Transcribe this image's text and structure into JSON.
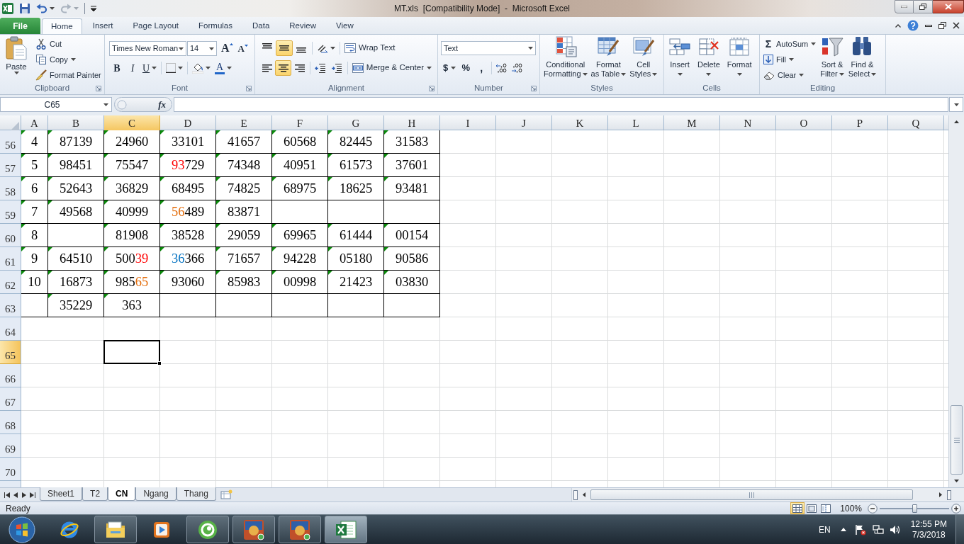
{
  "window": {
    "title": "MT.xls  [Compatibility Mode]  -  Microsoft Excel"
  },
  "ribbon_tabs": [
    {
      "label": "File",
      "kind": "file",
      "selected": false
    },
    {
      "label": "Home",
      "kind": "tab",
      "selected": true
    },
    {
      "label": "Insert",
      "kind": "tab",
      "selected": false
    },
    {
      "label": "Page Layout",
      "kind": "tab",
      "selected": false
    },
    {
      "label": "Formulas",
      "kind": "tab",
      "selected": false
    },
    {
      "label": "Data",
      "kind": "tab",
      "selected": false
    },
    {
      "label": "Review",
      "kind": "tab",
      "selected": false
    },
    {
      "label": "View",
      "kind": "tab",
      "selected": false
    }
  ],
  "clipboard": {
    "label": "Clipboard",
    "paste": "Paste",
    "cut": "Cut",
    "copy": "Copy",
    "format_painter": "Format Painter"
  },
  "font": {
    "label": "Font",
    "name": "Times New Roman",
    "size": "14",
    "grow": "A",
    "shrink": "A",
    "bold": "B",
    "italic": "I",
    "underline": "U",
    "color_letter": "A"
  },
  "alignment": {
    "label": "Alignment",
    "vertical": [
      {
        "kind": "top",
        "selected": false
      },
      {
        "kind": "middle",
        "selected": true
      },
      {
        "kind": "bottom",
        "selected": false
      }
    ],
    "horizontal": [
      {
        "kind": "left",
        "selected": false
      },
      {
        "kind": "center",
        "selected": true
      },
      {
        "kind": "right",
        "selected": false
      }
    ],
    "wrap_text": "Wrap Text",
    "merge_center": "Merge & Center"
  },
  "number": {
    "label": "Number",
    "format": "Text",
    "currency": "$",
    "percent": "%",
    "comma": ","
  },
  "styles": {
    "label": "Styles",
    "buttons": [
      {
        "kind": "conditional",
        "lines": [
          "Conditional",
          "Formatting"
        ]
      },
      {
        "kind": "table",
        "lines": [
          "Format",
          "as Table"
        ]
      },
      {
        "kind": "cell_styles",
        "lines": [
          "Cell",
          "Styles"
        ]
      }
    ]
  },
  "cells": {
    "label": "Cells",
    "buttons": [
      {
        "kind": "insert",
        "label": "Insert"
      },
      {
        "kind": "delete",
        "label": "Delete"
      },
      {
        "kind": "format",
        "label": "Format"
      }
    ]
  },
  "editing": {
    "label": "Editing",
    "sigma": "Σ",
    "autosum": "AutoSum",
    "fill": "Fill",
    "clear": "Clear",
    "sort": [
      "Sort &",
      "Filter"
    ],
    "find": [
      "Find &",
      "Select"
    ]
  },
  "formula_bar": {
    "name_box": "C65",
    "fx": "fx"
  },
  "sheet": {
    "columns": [
      {
        "label": "A",
        "selected": false
      },
      {
        "label": "B",
        "selected": false
      },
      {
        "label": "C",
        "selected": true
      },
      {
        "label": "D",
        "selected": false
      },
      {
        "label": "E",
        "selected": false
      },
      {
        "label": "F",
        "selected": false
      },
      {
        "label": "G",
        "selected": false
      },
      {
        "label": "H",
        "selected": false
      },
      {
        "label": "I",
        "selected": false
      },
      {
        "label": "J",
        "selected": false
      },
      {
        "label": "K",
        "selected": false
      },
      {
        "label": "L",
        "selected": false
      },
      {
        "label": "M",
        "selected": false
      },
      {
        "label": "N",
        "selected": false
      },
      {
        "label": "O",
        "selected": false
      },
      {
        "label": "P",
        "selected": false
      },
      {
        "label": "Q",
        "selected": false
      }
    ],
    "rows": [
      {
        "number": "56",
        "selected": false,
        "cells": [
          {
            "text": "4",
            "flag": true
          },
          {
            "text": "87139",
            "flag": true
          },
          {
            "text": "24960",
            "flag": true
          },
          {
            "text": "33101",
            "flag": true
          },
          {
            "text": "41657",
            "flag": true
          },
          {
            "text": "60568",
            "flag": true
          },
          {
            "text": "82445",
            "flag": true
          },
          {
            "text": "31583",
            "flag": true
          }
        ]
      },
      {
        "number": "57",
        "selected": false,
        "cells": [
          {
            "text": "5",
            "flag": true
          },
          {
            "text": "98451",
            "flag": true
          },
          {
            "text": "75547",
            "flag": true
          },
          {
            "parts": [
              {
                "text": "93",
                "color": "#ff0000"
              },
              {
                "text": "729",
                "color": "#000000"
              }
            ],
            "flag": true
          },
          {
            "text": "74348",
            "flag": true
          },
          {
            "text": "40951",
            "flag": true
          },
          {
            "text": "61573",
            "flag": true
          },
          {
            "text": "37601",
            "flag": true
          }
        ]
      },
      {
        "number": "58",
        "selected": false,
        "cells": [
          {
            "text": "6",
            "flag": true
          },
          {
            "text": "52643",
            "flag": true
          },
          {
            "text": "36829",
            "flag": true
          },
          {
            "text": "68495",
            "flag": true
          },
          {
            "text": "74825",
            "flag": true
          },
          {
            "text": "68975",
            "flag": true
          },
          {
            "text": "18625",
            "flag": true
          },
          {
            "text": "93481",
            "flag": true
          }
        ]
      },
      {
        "number": "59",
        "selected": false,
        "cells": [
          {
            "text": "7",
            "flag": true
          },
          {
            "text": "49568",
            "flag": true
          },
          {
            "text": "40999",
            "flag": true
          },
          {
            "parts": [
              {
                "text": "56",
                "color": "#e36c0a"
              },
              {
                "text": "489",
                "color": "#000000"
              }
            ],
            "flag": true
          },
          {
            "text": "83871",
            "flag": true
          },
          {
            "flag": false
          },
          {
            "flag": false
          },
          {
            "flag": false
          }
        ]
      },
      {
        "number": "60",
        "selected": false,
        "cells": [
          {
            "text": "8",
            "flag": true
          },
          {
            "flag": false
          },
          {
            "text": "81908",
            "flag": true
          },
          {
            "text": "38528",
            "flag": true
          },
          {
            "text": "29059",
            "flag": true
          },
          {
            "text": "69965",
            "flag": true
          },
          {
            "text": "61444",
            "flag": true
          },
          {
            "text": "00154",
            "flag": true
          }
        ]
      },
      {
        "number": "61",
        "selected": false,
        "cells": [
          {
            "text": "9",
            "flag": true
          },
          {
            "text": "64510",
            "flag": true
          },
          {
            "parts": [
              {
                "text": "500",
                "color": "#000000"
              },
              {
                "text": "39",
                "color": "#ff0000"
              }
            ],
            "flag": true
          },
          {
            "parts": [
              {
                "text": "36",
                "color": "#0070c0"
              },
              {
                "text": "366",
                "color": "#000000"
              }
            ],
            "flag": true
          },
          {
            "text": "71657",
            "flag": true
          },
          {
            "text": "94228",
            "flag": true
          },
          {
            "text": "05180",
            "flag": true
          },
          {
            "text": "90586",
            "flag": true
          }
        ]
      },
      {
        "number": "62",
        "selected": false,
        "cells": [
          {
            "text": "10",
            "flag": true
          },
          {
            "text": "16873",
            "flag": true
          },
          {
            "parts": [
              {
                "text": "985",
                "color": "#000000"
              },
              {
                "text": "65",
                "color": "#e36c0a"
              }
            ],
            "flag": true
          },
          {
            "text": "93060",
            "flag": true
          },
          {
            "text": "85983",
            "flag": true
          },
          {
            "text": "00998",
            "flag": true
          },
          {
            "text": "21423",
            "flag": true
          },
          {
            "text": "03830",
            "flag": true
          }
        ]
      },
      {
        "number": "63",
        "selected": false,
        "cells": [
          {
            "flag": false
          },
          {
            "text": "35229",
            "flag": true
          },
          {
            "text": "363",
            "flag": true
          },
          {
            "flag": false
          },
          {
            "flag": false
          },
          {
            "flag": false
          },
          {
            "flag": false
          },
          {
            "flag": false
          }
        ]
      },
      {
        "number": "64",
        "selected": false
      },
      {
        "number": "65",
        "selected": true
      },
      {
        "number": "66",
        "selected": false
      },
      {
        "number": "67",
        "selected": false
      },
      {
        "number": "68",
        "selected": false
      },
      {
        "number": "69",
        "selected": false
      },
      {
        "number": "70",
        "selected": false
      }
    ]
  },
  "sheet_tabs": [
    {
      "label": "Sheet1",
      "selected": false
    },
    {
      "label": "T2",
      "selected": false
    },
    {
      "label": "CN",
      "selected": true
    },
    {
      "label": "Ngang",
      "selected": false
    },
    {
      "label": "Thang",
      "selected": false
    }
  ],
  "status_bar": {
    "text": "Ready",
    "views": [
      {
        "kind": "normal",
        "selected": true
      },
      {
        "kind": "page_layout",
        "selected": false
      },
      {
        "kind": "page_break",
        "selected": false
      }
    ],
    "zoom": "100%",
    "zoom_slider": {
      "level": 0.5
    }
  },
  "taskbar": {
    "apps": [
      {
        "kind": "ie",
        "running": false,
        "selected": false
      },
      {
        "kind": "explorer",
        "running": true,
        "selected": false
      },
      {
        "kind": "media",
        "running": false,
        "selected": false
      },
      {
        "kind": "browser",
        "running": true,
        "selected": false
      },
      {
        "kind": "game",
        "running": true,
        "selected": false
      },
      {
        "kind": "game",
        "running": true,
        "selected": false
      },
      {
        "kind": "excel",
        "running": true,
        "selected": true
      }
    ],
    "language": "EN",
    "time": "12:55 PM",
    "date": "7/3/2018"
  }
}
